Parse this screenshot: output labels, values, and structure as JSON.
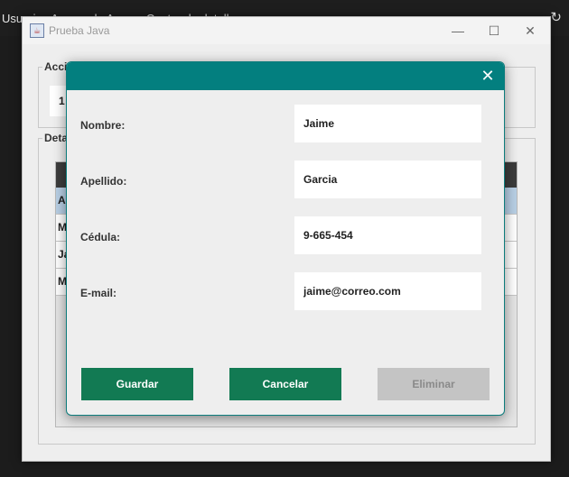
{
  "background": {
    "menu_text": "Usuarios   Acerca de   Acerca   Centro de detalles",
    "reload_icon": "reload-icon"
  },
  "window": {
    "title": "Prueba Java",
    "minimize": "—",
    "maximize": "☐",
    "close": "✕"
  },
  "acciones": {
    "legend": "Acci",
    "field_value": "1"
  },
  "detalles": {
    "legend": "Deta",
    "rows": [
      "An",
      "Ma",
      "Ja",
      "Ma"
    ]
  },
  "dialog": {
    "close": "✕",
    "fields": [
      {
        "label": "Nombre:",
        "value": "Jaime"
      },
      {
        "label": "Apellido:",
        "value": "Garcia"
      },
      {
        "label": "Cédula:",
        "value": "9-665-454"
      },
      {
        "label": "E-mail:",
        "value": "jaime@correo.com"
      }
    ],
    "buttons": {
      "save": "Guardar",
      "cancel": "Cancelar",
      "delete": "Eliminar"
    }
  },
  "colors": {
    "dialog_title": "#037f7f",
    "button_green": "#127a53",
    "button_disabled": "#c4c4c4",
    "selected_row": "#b8cfe5"
  }
}
